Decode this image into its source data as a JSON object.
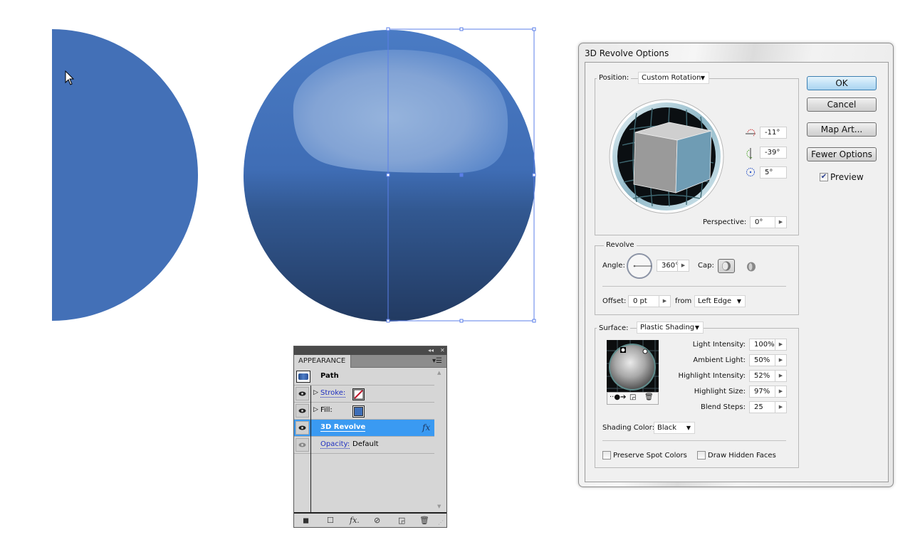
{
  "canvas": {
    "half_circle_color": "#4370b7",
    "sphere_colors": {
      "top": "#4a7bc4",
      "highlight": "#98b5dd",
      "bottom": "#243c63"
    },
    "selection_color": "#5b7fe8"
  },
  "appearance_panel": {
    "tab_label": "APPEARANCE",
    "header": {
      "label": "Path"
    },
    "rows": [
      {
        "label": "Stroke:",
        "swatch": "none"
      },
      {
        "label": "Fill:",
        "swatch": "#3f6fb8"
      },
      {
        "label": "3D Revolve",
        "badge": "fx"
      },
      {
        "label": "Opacity:",
        "value": "Default"
      }
    ],
    "footer_icons": [
      "new-stroke",
      "new-fill",
      "add-effect",
      "clear-appearance",
      "duplicate-item",
      "delete-item"
    ]
  },
  "dialog": {
    "title": "3D Revolve Options",
    "buttons": {
      "ok": "OK",
      "cancel": "Cancel",
      "map_art": "Map Art...",
      "fewer_options": "Fewer Options"
    },
    "preview": {
      "label": "Preview",
      "checked": true
    },
    "position": {
      "label": "Position:",
      "value": "Custom Rotation",
      "x_rotation": "-11°",
      "y_rotation": "-39°",
      "z_rotation": "5°",
      "perspective_label": "Perspective:",
      "perspective": "0°"
    },
    "revolve": {
      "legend": "Revolve",
      "angle_label": "Angle:",
      "angle": "360°",
      "cap_label": "Cap:",
      "offset_label": "Offset:",
      "offset": "0 pt",
      "from_label": "from",
      "from_value": "Left Edge"
    },
    "surface": {
      "label": "Surface:",
      "value": "Plastic Shading",
      "light_intensity_label": "Light Intensity:",
      "light_intensity": "100%",
      "ambient_light_label": "Ambient Light:",
      "ambient_light": "50%",
      "highlight_intensity_label": "Highlight Intensity:",
      "highlight_intensity": "52%",
      "highlight_size_label": "Highlight Size:",
      "highlight_size": "97%",
      "blend_steps_label": "Blend Steps:",
      "blend_steps": "25",
      "shading_color_label": "Shading Color:",
      "shading_color": "Black",
      "preserve_spot_colors": {
        "label": "Preserve Spot Colors",
        "checked": false
      },
      "draw_hidden_faces": {
        "label": "Draw Hidden Faces",
        "checked": false
      }
    }
  }
}
